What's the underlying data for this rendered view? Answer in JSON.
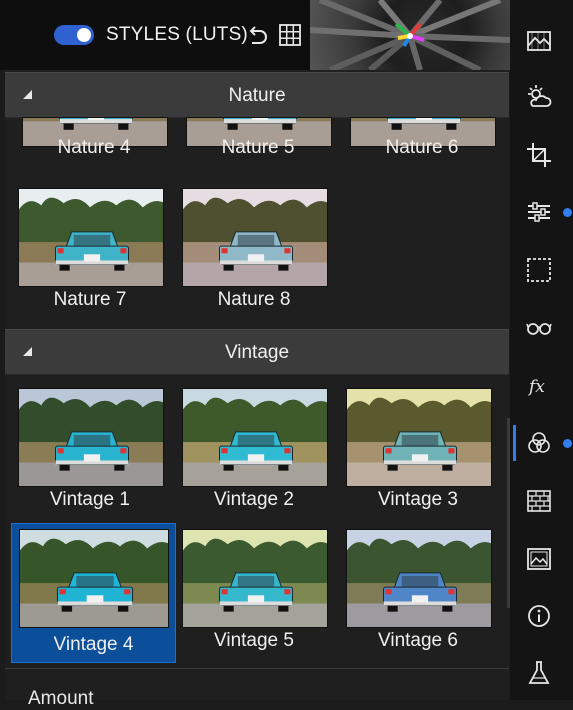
{
  "header": {
    "title": "STYLES (LUTS)",
    "toggle_on": true,
    "toggle_color": "#2f62d0"
  },
  "sections": [
    {
      "title": "Nature",
      "expanded": true,
      "tiles": [
        "Nature 4",
        "Nature 5",
        "Nature 6",
        "Nature 7",
        "Nature 8"
      ]
    },
    {
      "title": "Vintage",
      "expanded": true,
      "tiles": [
        "Vintage 1",
        "Vintage 2",
        "Vintage 3",
        "Vintage 4",
        "Vintage 5",
        "Vintage 6"
      ],
      "selected": "Vintage 4"
    }
  ],
  "amount_label": "Amount",
  "sidebar": {
    "icons": [
      "landscape-mask-icon",
      "sun-cloud-icon",
      "crop-icon",
      "sliders-icon",
      "selection-icon",
      "glasses-icon",
      "fx-icon",
      "color-circles-icon",
      "bricks-icon",
      "image-icon",
      "info-icon",
      "flask-icon"
    ],
    "active": "color-circles-icon",
    "accent": "#2f7ff0"
  }
}
